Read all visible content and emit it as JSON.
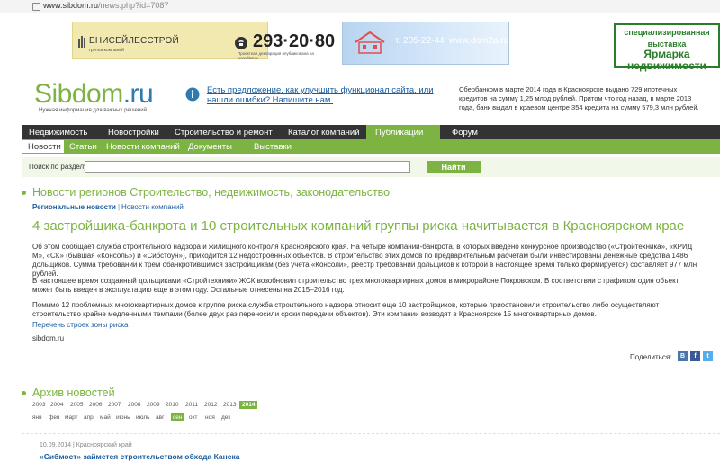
{
  "browser": {
    "url_host": "www.sibdom.ru",
    "url_path": "/news.php?id=7087"
  },
  "banners": {
    "b1": {
      "company": "ЕНИСЕЙЛЕССТРОЙ",
      "company_sub": "группа компаний",
      "phone": "293·20·80",
      "note": "Проектная декларация опубликована на www.li13.ru"
    },
    "b2": {
      "phone": "т. 205-22-44",
      "site": "www.dom2a.ru"
    },
    "b3": {
      "line1": "специализированная",
      "line2": "выставка",
      "line3": "Ярмарка",
      "line4": "недвижимости"
    }
  },
  "header": {
    "logo_main": "Sibdom",
    "logo_tld": ".ru",
    "tagline": "Нужная информация для важных решений",
    "suggest_link": "Есть предложение, как улучшить функционал сайта, или нашли ошибки? Напишите нам.",
    "side_news": "Сбербанком в марте 2014 года в Красноярске выдано 729 ипотечных кредитов на сумму 1,25 млрд рублей. Притом что год назад, в марте 2013 года, банк выдал в краевом центре 354 кредита на сумму 579,3 млн рублей."
  },
  "nav_main": [
    "Недвижимость",
    "Новостройки",
    "Строительство и ремонт",
    "Каталог компаний",
    "Публикации",
    "Форум"
  ],
  "nav_sub": [
    "Новости",
    "Статьи",
    "Новости компаний",
    "Документы",
    "Выставки"
  ],
  "search": {
    "label": "Поиск по разделу:",
    "value": "",
    "button": "Найти"
  },
  "section_title": "Новости регионов Строительство, недвижимость, законодательство",
  "breadcrumbs": {
    "current": "Региональные новости",
    "separator": "|",
    "link": "Новости компаний"
  },
  "article": {
    "title": "4 застройщика-банкрота и 10 строительных компаний группы риска начитывается в Красноярском крае",
    "p1": "Об этом сообщает служба строительного надзора и жилищного контроля Красноярского края. На четыре компании-банкрота, в которых введено конкурсное производство («Стройтехника», «КРИД М», «СК» (бывшая «Консоль») и «Сибстоун»), приходится 12 недостроенных объектов. В строительство этих домов по предварительным расчетам были инвестированы денежные средства 1486 дольщиков. Сумма требований к трем обанкротившимся застройщикам (без учета «Консоли», реестр требований дольщиков к которой в настоящее время только формируется) составляет 977 млн рублей.",
    "p2": "В настоящее время созданный дольщиками «Стройтехники» ЖСК возобновил строительство трех многоквартирных домов в микрорайоне Покровском. В соответствии с графиком один объект может быть введен в эксплуатацию еще в этом году. Остальные отнесены на 2015–2016 год.",
    "p3": "Помимо 12 проблемных многоквартирных домов к группе риска служба строительного надзора относит еще 10 застройщиков, которые приостановили строительство либо осуществляют строительство крайне медленными темпами (более двух раз переносили сроки передачи объектов). Эти компании возводят в Красноярске 15 многоквартирных домов.",
    "link": "Перечень строек зоны риска",
    "source": "sibdom.ru"
  },
  "share": {
    "label": "Поделиться:"
  },
  "archive": {
    "title": "Архив новостей",
    "years": [
      "2003",
      "2004",
      "2005",
      "2006",
      "2007",
      "2008",
      "2009",
      "2010",
      "2011",
      "2012",
      "2013",
      "2014"
    ],
    "months": [
      "янв",
      "фев",
      "март",
      "апр",
      "май",
      "июнь",
      "июль",
      "авг",
      "сен",
      "окт",
      "ноя",
      "дек"
    ]
  },
  "latest": {
    "date": "10.09.2014",
    "separator": "|",
    "region": "Красноярский край",
    "title": "«Сибмост» займется строительством обхода Канска"
  },
  "colors": {
    "green": "#7cb342",
    "dark_nav": "#333333",
    "link_blue": "#1a5da0"
  }
}
